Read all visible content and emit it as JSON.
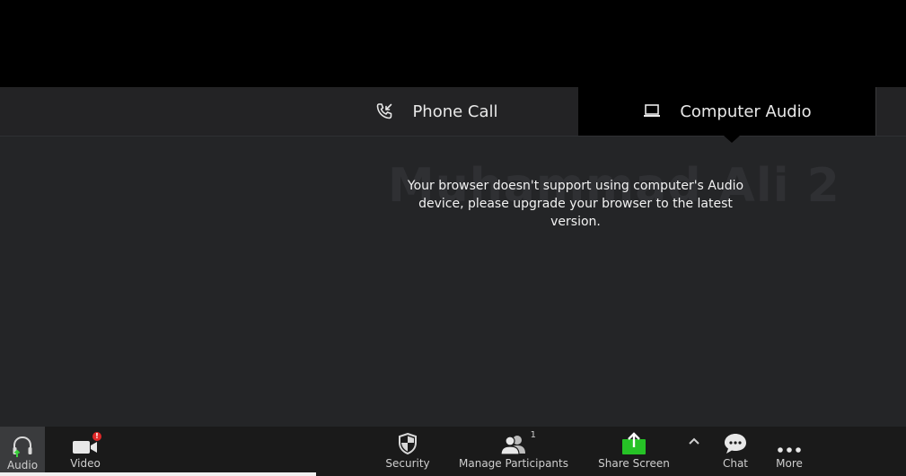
{
  "audio_tabs": {
    "phone_call": "Phone Call",
    "computer_audio": "Computer Audio",
    "selected": "Computer Audio"
  },
  "participant_name": "Muhammad Ali 2",
  "audio_message": "Your browser doesn't support using computer's Audio device, please upgrade your browser to the latest version.",
  "toolbar": {
    "audio_label": "Audio",
    "video_label": "Video",
    "video_alert": "!",
    "security_label": "Security",
    "participants_label": "Manage Participants",
    "participants_count": "1",
    "share_label": "Share Screen",
    "chat_label": "Chat",
    "more_label": "More"
  },
  "colors": {
    "main_bg": "#242527",
    "toolbar_bg": "#1a1a1a",
    "selected_tab_bg": "#000000",
    "share_green": "#26c226",
    "alert_red": "#e02828",
    "audio_arrow_green": "#3ad13a"
  },
  "icons": {
    "phone_call": "phone-incoming-icon",
    "computer_audio": "laptop-icon",
    "audio": "headphones-icon",
    "video": "video-camera-icon",
    "security": "shield-icon",
    "participants": "users-icon",
    "share": "share-screen-icon",
    "options": "caret-up-icon",
    "chat": "chat-bubble-icon",
    "more": "ellipsis-icon"
  }
}
